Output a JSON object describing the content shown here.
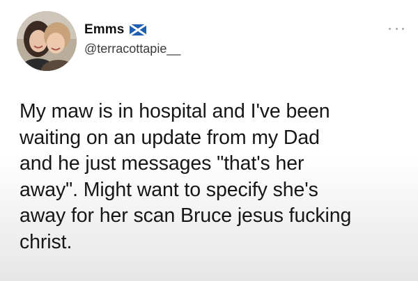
{
  "author": {
    "display_name": "Emms",
    "handle": "@terracottapie__",
    "flag_icon": "scotland-flag-icon",
    "avatar_icon": "avatar-photo"
  },
  "menu": {
    "icon": "more-options-icon"
  },
  "tweet": {
    "text": "My maw is in hospital and I've been\nwaiting on an update from my Dad\nand he just messages \"that's her\naway\". Might want to specify she's\naway for her scan Bruce jesus fucking\nchrist."
  },
  "colors": {
    "flag_blue": "#1f5fb0",
    "text": "#161616",
    "handle": "#3a3a3a"
  }
}
